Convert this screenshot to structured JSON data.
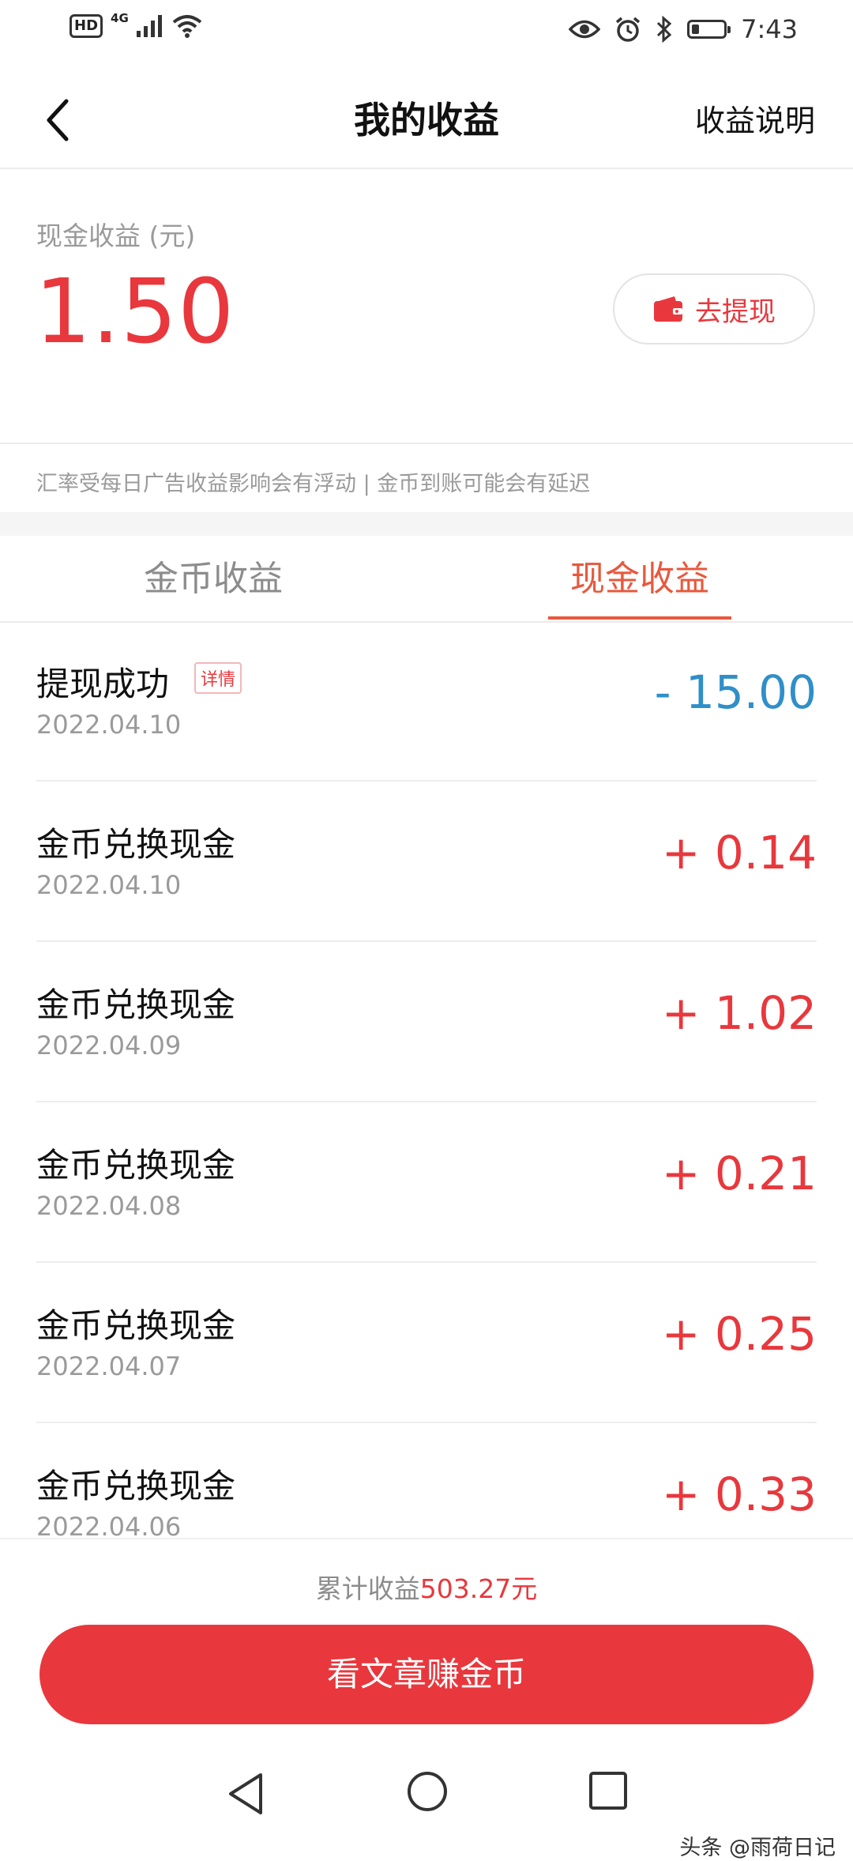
{
  "status_bar": {
    "hd": "HD",
    "network": "4G",
    "time": "7:43",
    "battery_level": 0.22,
    "icons": [
      "signal-icon",
      "wifi-icon",
      "eye-icon",
      "alarm-icon",
      "bluetooth-icon",
      "battery-icon"
    ]
  },
  "header": {
    "title": "我的收益",
    "right_link": "收益说明",
    "back_icon": "chevron-left-icon"
  },
  "cash": {
    "label": "现金收益 (元)",
    "value": "1.50",
    "withdraw_label": "去提现",
    "wallet_icon": "wallet-icon"
  },
  "notice": "汇率受每日广告收益影响会有浮动 | 金币到账可能会有延迟",
  "tabs": [
    {
      "label": "金币收益",
      "active": false
    },
    {
      "label": "现金收益",
      "active": true
    }
  ],
  "records": [
    {
      "title": "提现成功",
      "badge": "详情",
      "date": "2022.04.10",
      "amount": "- 15.00",
      "type": "negative"
    },
    {
      "title": "金币兑换现金",
      "date": "2022.04.10",
      "amount": "+ 0.14",
      "type": "positive"
    },
    {
      "title": "金币兑换现金",
      "date": "2022.04.09",
      "amount": "+ 1.02",
      "type": "positive"
    },
    {
      "title": "金币兑换现金",
      "date": "2022.04.08",
      "amount": "+ 0.21",
      "type": "positive"
    },
    {
      "title": "金币兑换现金",
      "date": "2022.04.07",
      "amount": "+ 0.25",
      "type": "positive"
    },
    {
      "title": "金币兑换现金",
      "date": "2022.04.06",
      "amount": "+ 0.33",
      "type": "positive"
    }
  ],
  "footer": {
    "total_label": "累计收益",
    "total_value": "503.27元",
    "cta_label": "看文章赚金币"
  },
  "watermark": "头条 @雨荷日记",
  "colors": {
    "accent": "#e8383d",
    "tab_active": "#e8583d",
    "negative_amount": "#2f8fc9",
    "muted_text": "#9a9a9a"
  }
}
